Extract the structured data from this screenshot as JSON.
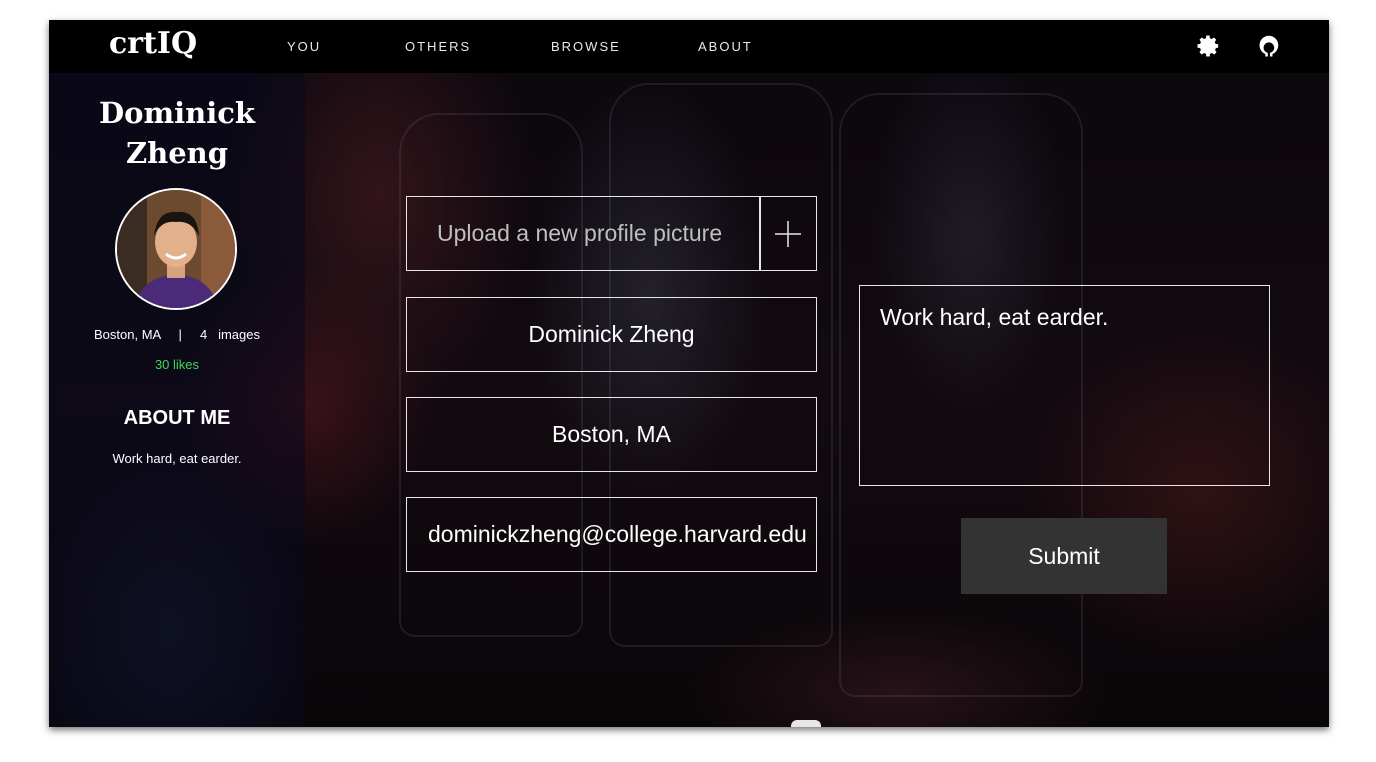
{
  "nav": {
    "logo": "crtIQ",
    "items": [
      "YOU",
      "OTHERS",
      "BROWSE",
      "ABOUT"
    ],
    "icons": [
      "gear-icon",
      "github-icon"
    ]
  },
  "sidebar": {
    "first_name": "Dominick",
    "last_name": "Zheng",
    "location": "Boston, MA",
    "separator": "|",
    "images_count": "4",
    "images_label": "images",
    "likes": "30 likes",
    "about_heading": "ABOUT ME",
    "about_text": "Work hard, eat earder."
  },
  "form": {
    "upload_placeholder": "Upload a new profile picture",
    "name_value": "Dominick Zheng",
    "location_value": "Boston, MA",
    "email_value": "dominickzheng@college.harvard.edu",
    "bio_value": "Work hard, eat earder.",
    "submit_label": "Submit"
  },
  "colors": {
    "likes": "#3fd65a",
    "navbar": "#000000",
    "submit_bg": "#333333"
  }
}
